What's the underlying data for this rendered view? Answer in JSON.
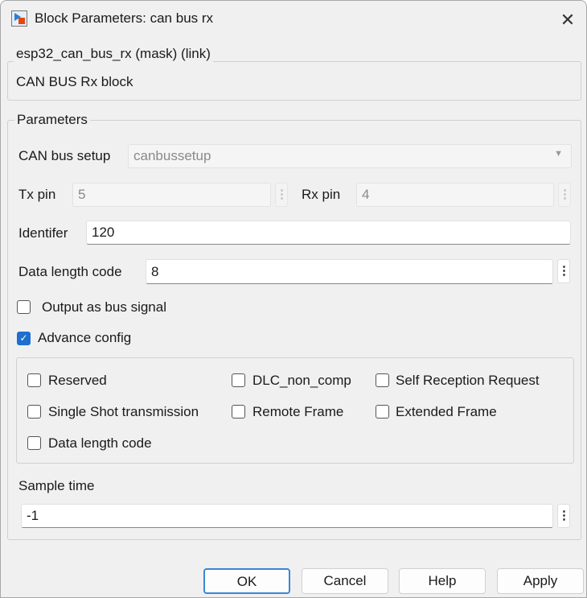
{
  "window": {
    "title": "Block Parameters: can bus rx"
  },
  "mask": {
    "legend": "esp32_can_bus_rx (mask) (link)",
    "description": "CAN BUS Rx block"
  },
  "parameters": {
    "legend": "Parameters",
    "can_bus_setup": {
      "label": "CAN bus setup",
      "value": "canbussetup"
    },
    "tx_pin": {
      "label": "Tx pin",
      "value": "5"
    },
    "rx_pin": {
      "label": "Rx pin",
      "value": "4"
    },
    "identifier": {
      "label": "Identifer",
      "value": "120"
    },
    "dlc": {
      "label": "Data length code",
      "value": "8"
    },
    "output_bus": {
      "label": "Output as bus signal",
      "checked": false
    },
    "advance": {
      "label": "Advance config",
      "checked": true
    },
    "advanced_options": [
      {
        "label": "Reserved",
        "checked": false
      },
      {
        "label": "DLC_non_comp",
        "checked": false
      },
      {
        "label": "Self Reception Request",
        "checked": false
      },
      {
        "label": "Single Shot transmission",
        "checked": false
      },
      {
        "label": "Remote Frame",
        "checked": false
      },
      {
        "label": "Extended Frame",
        "checked": false
      },
      {
        "label": "Data length code",
        "checked": false
      }
    ],
    "sample_time": {
      "label": "Sample time",
      "value": "-1"
    }
  },
  "buttons": {
    "ok": "OK",
    "cancel": "Cancel",
    "help": "Help",
    "apply": "Apply"
  },
  "colors": {
    "accent": "#1d6fd0",
    "default_button_border": "#3a86d8"
  }
}
